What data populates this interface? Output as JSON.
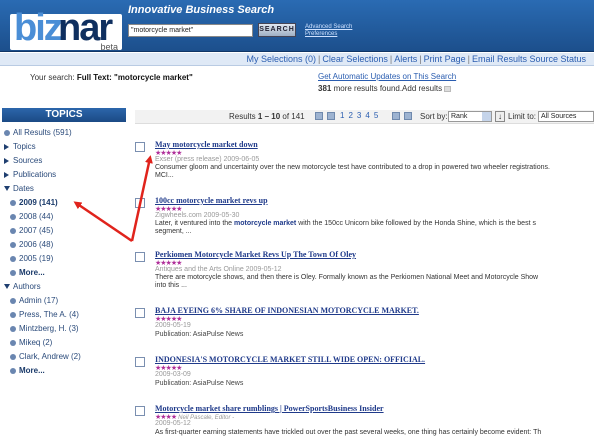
{
  "header": {
    "logo_biz": "biz",
    "logo_nar": "nar",
    "logo_beta": "beta",
    "tagline": "Innovative Business Search",
    "search_value": "\"motorcycle market\"",
    "search_button": "SEARCH",
    "advanced_search": "Advanced Search",
    "preferences": "Preferences"
  },
  "nav": {
    "items": [
      "My Selections (0)",
      "Clear Selections",
      "Alerts",
      "Print Page",
      "Email Results",
      "Source Status"
    ]
  },
  "summary": {
    "prefix": "Your search: ",
    "query": "Full Text: \"motorcycle market\"",
    "auto_updates": "Get Automatic Updates on This Search",
    "more_count": "381",
    "more_text": " more results found.Add results"
  },
  "sidebar": {
    "title": "TOPICS",
    "all_results": "All Results (591)",
    "topics": "Topics",
    "sources": "Sources",
    "publications": "Publications",
    "dates": "Dates",
    "date_items": [
      "2009 (141)",
      "2008 (44)",
      "2007 (45)",
      "2006 (48)",
      "2005 (19)"
    ],
    "more_dates": "More...",
    "authors": "Authors",
    "author_items": [
      "Admin (17)",
      "Press, The A. (4)",
      "Mintzberg, H. (3)",
      "Mikeq (2)",
      "Clark, Andrew (2)"
    ],
    "more_authors": "More..."
  },
  "toolbar": {
    "results_prefix": "Results ",
    "results_range": "1 – 10",
    "results_suffix": " of 141",
    "pages": [
      "1",
      "2",
      "3",
      "4",
      "5"
    ],
    "sort_label": "Sort by:",
    "sort_value": "Rank",
    "limit_label": "Limit to:",
    "limit_value": "All Sources"
  },
  "results": [
    {
      "title": "May motorcycle market down",
      "stars": "★★★★★",
      "meta": "Exser (press release)  2009-06-05",
      "snippet_before": "Consumer gloom and uncertainty over the new motorcycle test have contributed to a drop in powered two wheeler registrations.",
      "snippet_line2": "MCI..."
    },
    {
      "title": "100cc motorcycle market revs up",
      "stars": "★★★★★",
      "meta": "Zigwheels.com  2009-05-30",
      "snippet_pre": "Later, it ventured into the ",
      "snippet_hl": "motorcycle market",
      "snippet_post": " with the 150cc Unicorn bike followed by the Honda Shine, which is the best s",
      "snippet_line2": "segment, ..."
    },
    {
      "title": "Perkiomen Motorcycle Market Revs Up The Town Of Oley",
      "stars": "★★★★★",
      "meta": "Antiques and the Arts Online  2009-05-12",
      "snippet_before": "There are motorcycle shows, and then there is Oley. Formally known as the Perkiomen National Meet and Motorcycle Show",
      "snippet_line2": "into this ..."
    },
    {
      "title": "BAJA EYEING 6% SHARE OF INDONESIAN MOTORCYCLE MARKET.",
      "stars": "★★★★★",
      "meta": "2009-05-19",
      "publication": "Publication:  AsiaPulse News"
    },
    {
      "title": "INDONESIA'S MOTORCYCLE MARKET STILL WIDE OPEN: OFFICIAL.",
      "stars": "★★★★★",
      "meta": "2009-03-09",
      "publication": "Publication:  AsiaPulse News"
    },
    {
      "title": "Motorcycle market share rumblings | PowerSportsBusiness Insider",
      "stars": "★★★★",
      "author": "Neil Pascale, Editor -",
      "meta": "2009-05-12",
      "snippet_before": "As first-quarter earning statements have trickled out over the past several weeks, one thing has certainly become evident: Th"
    }
  ],
  "colors": {
    "header_blue": "#1c4f8c",
    "link_blue": "#2a5db0",
    "stars": "#b0309a",
    "arrow_red": "#e0231c"
  }
}
